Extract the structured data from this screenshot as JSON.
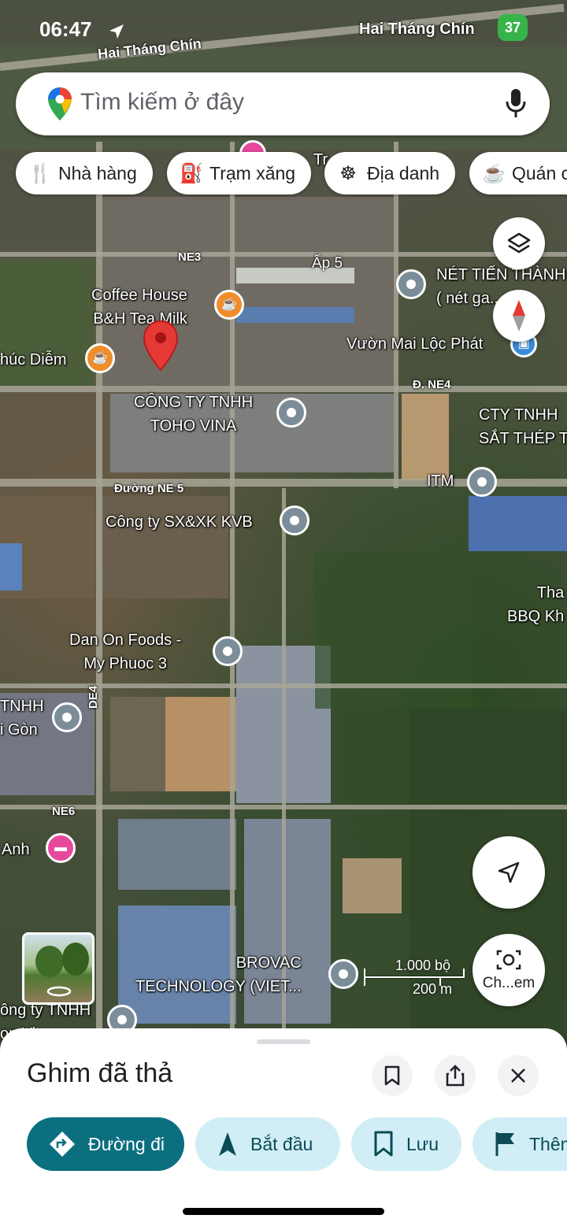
{
  "status_bar": {
    "time": "06:47",
    "location_arrow": "location-arrow-icon",
    "battery": "37"
  },
  "search": {
    "placeholder": "Tìm kiếm ở đây",
    "logo": "google-maps-pin-icon",
    "mic": "mic-icon"
  },
  "chips": [
    {
      "label": "Nhà hàng",
      "icon": "restaurant-icon"
    },
    {
      "label": "Trạm xăng",
      "icon": "gas-station-icon"
    },
    {
      "label": "Địa danh",
      "icon": "landmark-icon"
    },
    {
      "label": "Quán c",
      "icon": "coffee-icon"
    }
  ],
  "map": {
    "roads": [
      "Hai Tháng Chín",
      "Hai Tháng Chín",
      "NE3",
      "Ấp 5",
      "Đ. NE4",
      "Đường NE 5",
      "DE4",
      "NE6"
    ],
    "places": [
      {
        "name": "Coffee House\nB&H Tea Milk",
        "type": "cafe"
      },
      {
        "name": "húc Diễm",
        "type": "cafe"
      },
      {
        "name": "NÉT TIẾN THÀNH\n( nét ga...nlin",
        "type": "generic"
      },
      {
        "name": "Vườn Mai Lộc Phát",
        "type": "shop"
      },
      {
        "name": "CÔNG TY TNHH\nTOHO VINA",
        "type": "generic"
      },
      {
        "name": "CTY TNHH\nSẮT THÉP T",
        "type": "generic"
      },
      {
        "name": "ITM",
        "type": "generic"
      },
      {
        "name": "Công ty SX&XK KVB",
        "type": "generic"
      },
      {
        "name": "Tha\nBBQ Kh",
        "type": "generic"
      },
      {
        "name": "Dan On Foods -\nMy Phuoc 3",
        "type": "generic"
      },
      {
        "name": "TNHH\ni Gòn",
        "type": "generic"
      },
      {
        "name": "Anh",
        "type": "hotel"
      },
      {
        "name": "BROVAC\nTECHNOLOGY (VIET...",
        "type": "generic"
      },
      {
        "name": "ông ty TNHH\non Vi...",
        "type": "generic"
      },
      {
        "name": "Tr",
        "type": "generic"
      }
    ],
    "dropped_pin": "dropped-pin-icon",
    "scale": {
      "imperial": "1.000 bộ",
      "metric": "200 m"
    },
    "controls": {
      "layers": "layers-icon",
      "compass": "compass-icon",
      "my_location": "navigation-arrow-icon",
      "lens_label": "Ch...em"
    }
  },
  "sheet": {
    "title": "Ghim đã thả",
    "actions": [
      {
        "label": "Đường đi",
        "icon": "directions-icon",
        "primary": true
      },
      {
        "label": "Bắt đầu",
        "icon": "navigation-icon",
        "primary": false
      },
      {
        "label": "Lưu",
        "icon": "bookmark-icon",
        "primary": false
      },
      {
        "label": "Thêm",
        "icon": "flag-icon",
        "primary": false
      }
    ]
  },
  "colors": {
    "primary": "#0b6f80",
    "secondary": "#d1eef6",
    "pin": "#e53935",
    "battery": "#37b34a"
  }
}
